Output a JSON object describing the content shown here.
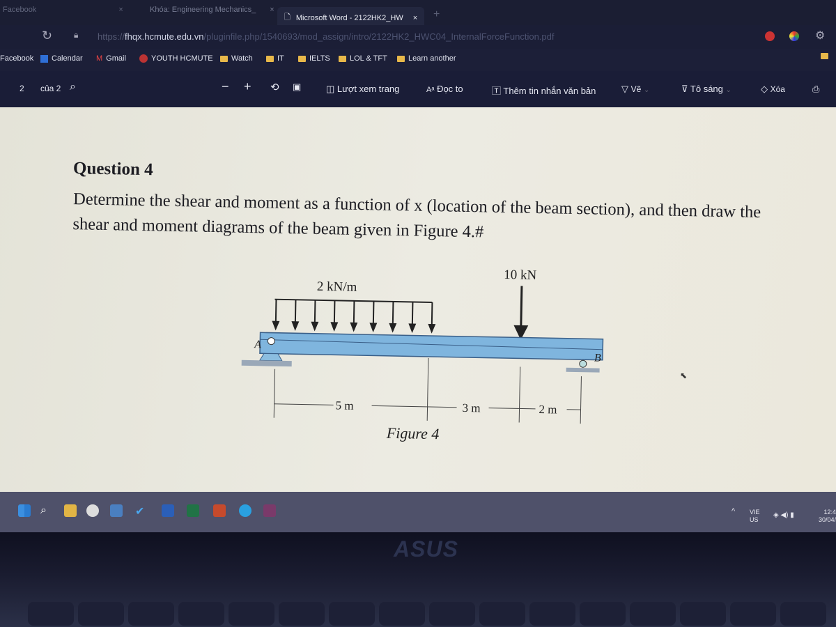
{
  "browser": {
    "tabs": [
      {
        "label": "Facebook"
      },
      {
        "label": "Khóa: Engineering Mechanics_"
      },
      {
        "label": "Microsoft Word - 2122HK2_HW",
        "active": true
      }
    ],
    "new_tab": "+",
    "close": "×",
    "address": {
      "domain": "fhqx.hcmute.edu.vn",
      "path": "/pluginfile.php/1540693/mod_assign/intro/2122HK2_HWC04_InternalForceFunction.pdf",
      "scheme": "https://"
    },
    "bookmarks": [
      {
        "label": "Facebook"
      },
      {
        "label": "Calendar"
      },
      {
        "label": "Gmail"
      },
      {
        "label": "YOUTH HCMUTE"
      },
      {
        "label": "Watch",
        "icon": "folder"
      },
      {
        "label": "IT",
        "icon": "folder"
      },
      {
        "label": "IELTS",
        "icon": "folder"
      },
      {
        "label": "LOL & TFT",
        "icon": "folder"
      },
      {
        "label": "Learn another",
        "icon": "folder"
      }
    ]
  },
  "pdf_toolbar": {
    "page_current": "2",
    "page_total": "của 2",
    "zoom_out": "−",
    "zoom_in": "+",
    "page_view": "Lượt xem trang",
    "read_aloud": "Đọc to",
    "add_text": "Thêm tin nhắn văn bản",
    "draw": "Vẽ",
    "highlight": "Tô sáng",
    "erase": "Xóa"
  },
  "document": {
    "heading": "Question 4",
    "body": "Determine the shear and moment as a function of x (location of the beam section), and then draw the shear and moment diagrams of the beam given in Figure 4.#",
    "figure": {
      "dist_load": "2 kN/m",
      "point_load": "10 kN",
      "support_a": "A",
      "support_b": "B",
      "dims": [
        "5 m",
        "3 m",
        "2 m"
      ],
      "caption": "Figure 4"
    }
  },
  "taskbar": {
    "lang_top": "VIE",
    "lang_bottom": "US",
    "time": "12:4",
    "date": "30/04/"
  },
  "laptop": {
    "brand": "ASUS"
  }
}
